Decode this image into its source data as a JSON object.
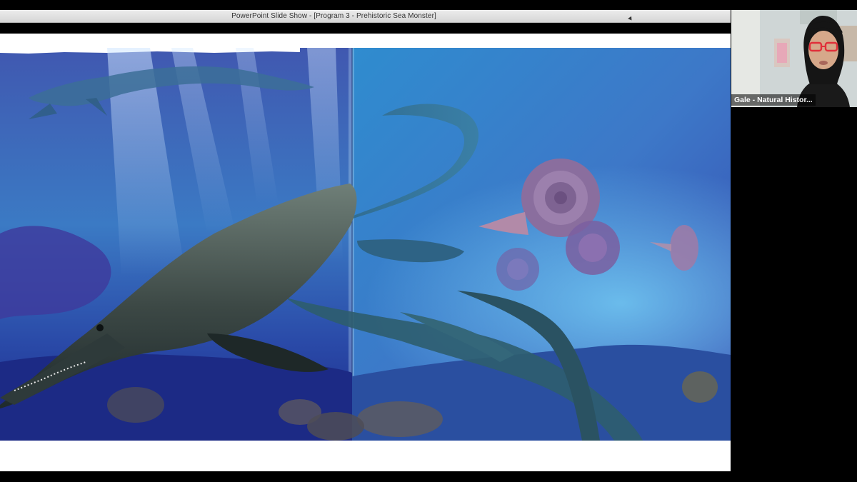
{
  "window": {
    "title": "PowerPoint Slide Show - [Program 3 - Prehistoric Sea Monster]"
  },
  "slide": {
    "image_subject": "underwater-prehistoric-sea-creatures-illustration"
  },
  "video": {
    "participant_name": "Gale - Natural Histor..."
  },
  "colors": {
    "background": "#000000",
    "titlebar": "#e0e0e0",
    "slide_bg": "#ffffff",
    "water_top": "#2f4fa6",
    "water_mid": "#2c7fbf",
    "seafloor": "#1d2f8a"
  }
}
